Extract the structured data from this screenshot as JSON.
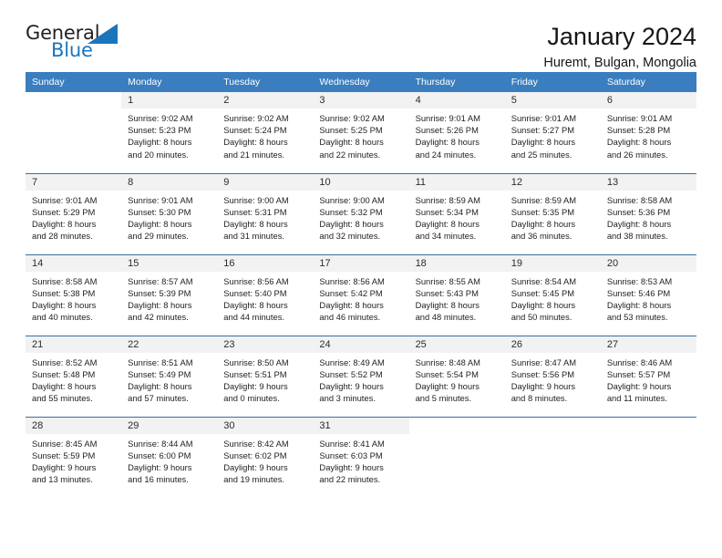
{
  "brand": {
    "word_general": "General",
    "word_blue": "Blue",
    "accent_color": "#1b75bb"
  },
  "header": {
    "title": "January 2024",
    "location": "Huremt, Bulgan, Mongolia",
    "header_bg": "#3a7ebf",
    "daynum_bg": "#f2f2f2"
  },
  "weekdays": [
    "Sunday",
    "Monday",
    "Tuesday",
    "Wednesday",
    "Thursday",
    "Friday",
    "Saturday"
  ],
  "weeks": [
    [
      {
        "day": ""
      },
      {
        "day": "1",
        "sunrise": "Sunrise: 9:02 AM",
        "sunset": "Sunset: 5:23 PM",
        "daylight1": "Daylight: 8 hours",
        "daylight2": "and 20 minutes."
      },
      {
        "day": "2",
        "sunrise": "Sunrise: 9:02 AM",
        "sunset": "Sunset: 5:24 PM",
        "daylight1": "Daylight: 8 hours",
        "daylight2": "and 21 minutes."
      },
      {
        "day": "3",
        "sunrise": "Sunrise: 9:02 AM",
        "sunset": "Sunset: 5:25 PM",
        "daylight1": "Daylight: 8 hours",
        "daylight2": "and 22 minutes."
      },
      {
        "day": "4",
        "sunrise": "Sunrise: 9:01 AM",
        "sunset": "Sunset: 5:26 PM",
        "daylight1": "Daylight: 8 hours",
        "daylight2": "and 24 minutes."
      },
      {
        "day": "5",
        "sunrise": "Sunrise: 9:01 AM",
        "sunset": "Sunset: 5:27 PM",
        "daylight1": "Daylight: 8 hours",
        "daylight2": "and 25 minutes."
      },
      {
        "day": "6",
        "sunrise": "Sunrise: 9:01 AM",
        "sunset": "Sunset: 5:28 PM",
        "daylight1": "Daylight: 8 hours",
        "daylight2": "and 26 minutes."
      }
    ],
    [
      {
        "day": "7",
        "sunrise": "Sunrise: 9:01 AM",
        "sunset": "Sunset: 5:29 PM",
        "daylight1": "Daylight: 8 hours",
        "daylight2": "and 28 minutes."
      },
      {
        "day": "8",
        "sunrise": "Sunrise: 9:01 AM",
        "sunset": "Sunset: 5:30 PM",
        "daylight1": "Daylight: 8 hours",
        "daylight2": "and 29 minutes."
      },
      {
        "day": "9",
        "sunrise": "Sunrise: 9:00 AM",
        "sunset": "Sunset: 5:31 PM",
        "daylight1": "Daylight: 8 hours",
        "daylight2": "and 31 minutes."
      },
      {
        "day": "10",
        "sunrise": "Sunrise: 9:00 AM",
        "sunset": "Sunset: 5:32 PM",
        "daylight1": "Daylight: 8 hours",
        "daylight2": "and 32 minutes."
      },
      {
        "day": "11",
        "sunrise": "Sunrise: 8:59 AM",
        "sunset": "Sunset: 5:34 PM",
        "daylight1": "Daylight: 8 hours",
        "daylight2": "and 34 minutes."
      },
      {
        "day": "12",
        "sunrise": "Sunrise: 8:59 AM",
        "sunset": "Sunset: 5:35 PM",
        "daylight1": "Daylight: 8 hours",
        "daylight2": "and 36 minutes."
      },
      {
        "day": "13",
        "sunrise": "Sunrise: 8:58 AM",
        "sunset": "Sunset: 5:36 PM",
        "daylight1": "Daylight: 8 hours",
        "daylight2": "and 38 minutes."
      }
    ],
    [
      {
        "day": "14",
        "sunrise": "Sunrise: 8:58 AM",
        "sunset": "Sunset: 5:38 PM",
        "daylight1": "Daylight: 8 hours",
        "daylight2": "and 40 minutes."
      },
      {
        "day": "15",
        "sunrise": "Sunrise: 8:57 AM",
        "sunset": "Sunset: 5:39 PM",
        "daylight1": "Daylight: 8 hours",
        "daylight2": "and 42 minutes."
      },
      {
        "day": "16",
        "sunrise": "Sunrise: 8:56 AM",
        "sunset": "Sunset: 5:40 PM",
        "daylight1": "Daylight: 8 hours",
        "daylight2": "and 44 minutes."
      },
      {
        "day": "17",
        "sunrise": "Sunrise: 8:56 AM",
        "sunset": "Sunset: 5:42 PM",
        "daylight1": "Daylight: 8 hours",
        "daylight2": "and 46 minutes."
      },
      {
        "day": "18",
        "sunrise": "Sunrise: 8:55 AM",
        "sunset": "Sunset: 5:43 PM",
        "daylight1": "Daylight: 8 hours",
        "daylight2": "and 48 minutes."
      },
      {
        "day": "19",
        "sunrise": "Sunrise: 8:54 AM",
        "sunset": "Sunset: 5:45 PM",
        "daylight1": "Daylight: 8 hours",
        "daylight2": "and 50 minutes."
      },
      {
        "day": "20",
        "sunrise": "Sunrise: 8:53 AM",
        "sunset": "Sunset: 5:46 PM",
        "daylight1": "Daylight: 8 hours",
        "daylight2": "and 53 minutes."
      }
    ],
    [
      {
        "day": "21",
        "sunrise": "Sunrise: 8:52 AM",
        "sunset": "Sunset: 5:48 PM",
        "daylight1": "Daylight: 8 hours",
        "daylight2": "and 55 minutes."
      },
      {
        "day": "22",
        "sunrise": "Sunrise: 8:51 AM",
        "sunset": "Sunset: 5:49 PM",
        "daylight1": "Daylight: 8 hours",
        "daylight2": "and 57 minutes."
      },
      {
        "day": "23",
        "sunrise": "Sunrise: 8:50 AM",
        "sunset": "Sunset: 5:51 PM",
        "daylight1": "Daylight: 9 hours",
        "daylight2": "and 0 minutes."
      },
      {
        "day": "24",
        "sunrise": "Sunrise: 8:49 AM",
        "sunset": "Sunset: 5:52 PM",
        "daylight1": "Daylight: 9 hours",
        "daylight2": "and 3 minutes."
      },
      {
        "day": "25",
        "sunrise": "Sunrise: 8:48 AM",
        "sunset": "Sunset: 5:54 PM",
        "daylight1": "Daylight: 9 hours",
        "daylight2": "and 5 minutes."
      },
      {
        "day": "26",
        "sunrise": "Sunrise: 8:47 AM",
        "sunset": "Sunset: 5:56 PM",
        "daylight1": "Daylight: 9 hours",
        "daylight2": "and 8 minutes."
      },
      {
        "day": "27",
        "sunrise": "Sunrise: 8:46 AM",
        "sunset": "Sunset: 5:57 PM",
        "daylight1": "Daylight: 9 hours",
        "daylight2": "and 11 minutes."
      }
    ],
    [
      {
        "day": "28",
        "sunrise": "Sunrise: 8:45 AM",
        "sunset": "Sunset: 5:59 PM",
        "daylight1": "Daylight: 9 hours",
        "daylight2": "and 13 minutes."
      },
      {
        "day": "29",
        "sunrise": "Sunrise: 8:44 AM",
        "sunset": "Sunset: 6:00 PM",
        "daylight1": "Daylight: 9 hours",
        "daylight2": "and 16 minutes."
      },
      {
        "day": "30",
        "sunrise": "Sunrise: 8:42 AM",
        "sunset": "Sunset: 6:02 PM",
        "daylight1": "Daylight: 9 hours",
        "daylight2": "and 19 minutes."
      },
      {
        "day": "31",
        "sunrise": "Sunrise: 8:41 AM",
        "sunset": "Sunset: 6:03 PM",
        "daylight1": "Daylight: 9 hours",
        "daylight2": "and 22 minutes."
      },
      {
        "day": ""
      },
      {
        "day": ""
      },
      {
        "day": ""
      }
    ]
  ]
}
